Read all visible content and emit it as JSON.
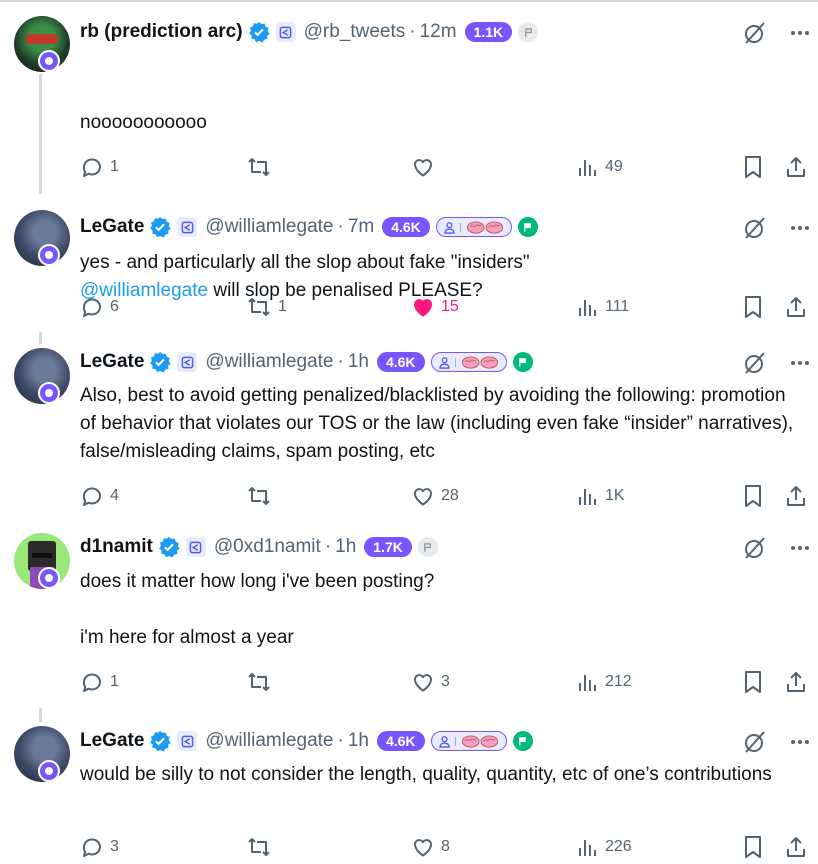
{
  "tweets": [
    {
      "name": "rb (prediction arc)",
      "handle": "@rb_tweets",
      "time": "12m",
      "score": "1.1K",
      "text_line1": "nooooooooooo",
      "mention": "@williamlegate",
      "text_rest": " will slop be penalised PLEASE?",
      "replies": "1",
      "retweets": "",
      "likes": "",
      "views": "49",
      "liked": false
    },
    {
      "name": "LeGate",
      "handle": "@williamlegate",
      "time": "7m",
      "score": "4.6K",
      "text": "yes - and particularly all the slop about fake \"insiders\"",
      "replies": "6",
      "retweets": "1",
      "likes": "15",
      "views": "111",
      "liked": true
    },
    {
      "name": "LeGate",
      "handle": "@williamlegate",
      "time": "1h",
      "score": "4.6K",
      "text": "Also, best to avoid getting penalized/blacklisted by avoiding the following: promotion of behavior that violates our TOS or the law (including even fake “insider” narratives), false/misleading claims, spam posting, etc",
      "replies": "4",
      "retweets": "",
      "likes": "28",
      "views": "1K",
      "liked": false
    },
    {
      "name": "d1namit",
      "handle": "@0xd1namit",
      "time": "1h",
      "score": "1.7K",
      "text": "does it matter how long i've been posting?\n\ni'm here for almost a year",
      "replies": "1",
      "retweets": "",
      "likes": "3",
      "views": "212",
      "liked": false
    },
    {
      "name": "LeGate",
      "handle": "@williamlegate",
      "time": "1h",
      "score": "4.6K",
      "text": "would be silly to not consider the length, quality, quantity, etc of one’s contributions",
      "replies": "3",
      "retweets": "",
      "likes": "8",
      "views": "226",
      "liked": false
    }
  ],
  "separator": "·",
  "colors": {
    "accent": "#7856ff",
    "link": "#1d9bf0",
    "like": "#f91880",
    "verified": "#1d9bf0",
    "muted": "#536471"
  },
  "icons": [
    "verified-badge-icon",
    "affiliate-icon",
    "grey-flag-icon",
    "person-icon",
    "brain-icon",
    "green-flag-icon",
    "slashed-circle-icon",
    "more-icon",
    "reply-icon",
    "retweet-icon",
    "like-icon",
    "views-icon",
    "bookmark-icon",
    "share-icon"
  ]
}
